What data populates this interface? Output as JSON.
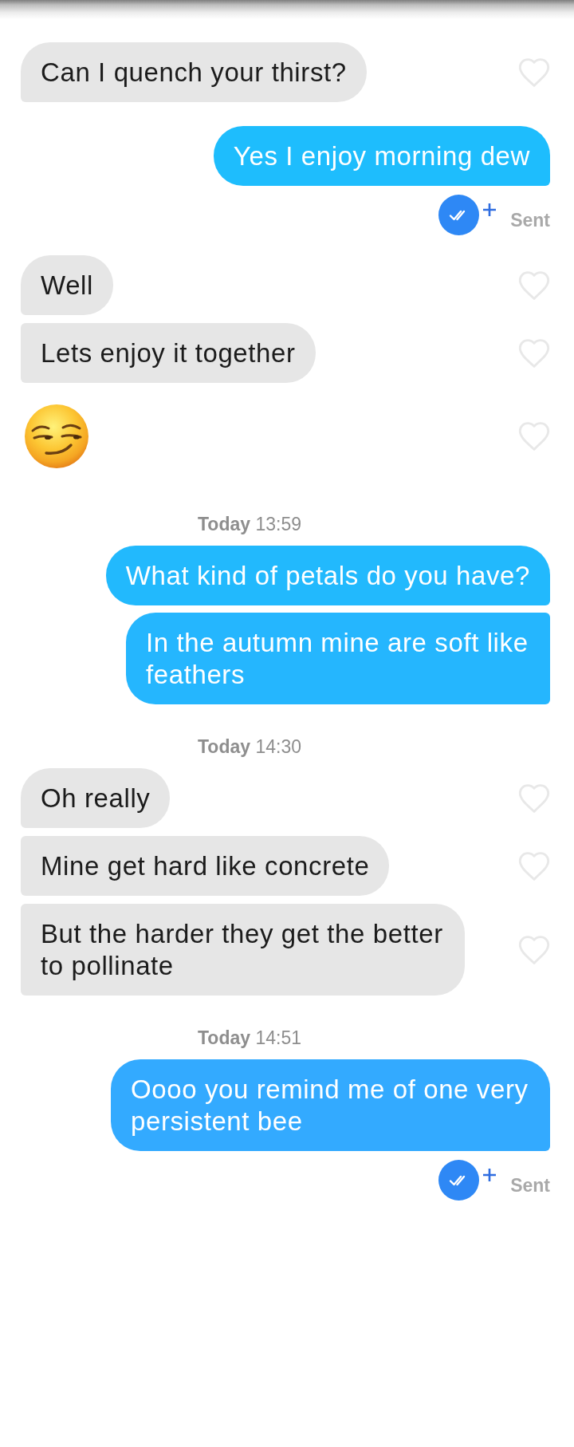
{
  "messages": [
    {
      "kind": "received",
      "text": "Can I quench your thirst?",
      "liked": false
    },
    {
      "kind": "sent",
      "text": "Yes I enjoy morning dew",
      "color": "#1ebdfd",
      "status": "Sent"
    },
    {
      "kind": "received",
      "text": "Well",
      "liked": false
    },
    {
      "kind": "received",
      "text": "Lets enjoy it together",
      "liked": false
    },
    {
      "kind": "emoji",
      "liked": false
    },
    {
      "kind": "timestamp",
      "text": "**Today** 13:59"
    },
    {
      "kind": "sent",
      "text": "What kind of petals do you have?",
      "color": "#22b9fd"
    },
    {
      "kind": "sent",
      "text": "In the autumn mine are soft like feathers",
      "color": "#25b6fe"
    },
    {
      "kind": "timestamp",
      "text": "**Today** 14:30"
    },
    {
      "kind": "received",
      "text": "Oh really",
      "liked": false
    },
    {
      "kind": "received",
      "text": "Mine get hard like concrete",
      "liked": false
    },
    {
      "kind": "received",
      "text": "But the harder they get the better to pollinate",
      "liked": false
    },
    {
      "kind": "timestamp",
      "text": "**Today** 14:51"
    },
    {
      "kind": "sent",
      "text": "Oooo you remind me of one very persistent bee",
      "color": "#33aaff",
      "status": "Sent"
    }
  ]
}
